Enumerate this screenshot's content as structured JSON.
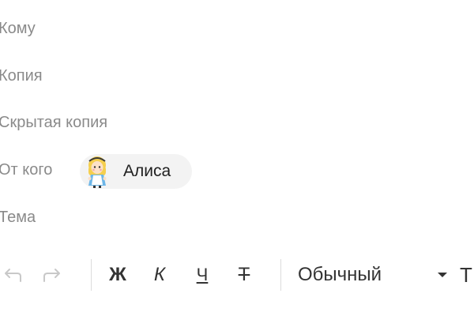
{
  "compose": {
    "to_label": "Кому",
    "cc_label": "Копия",
    "bcc_label": "Скрытая копия",
    "from_label": "От кого",
    "subject_label": "Тема",
    "sender": {
      "name": "Алиса",
      "avatar_icon": "alice-avatar-icon"
    }
  },
  "toolbar": {
    "undo_icon": "undo-icon",
    "redo_icon": "redo-icon",
    "bold_label": "Ж",
    "italic_label": "К",
    "underline_label": "Ч",
    "strikethrough_label": "Т",
    "paragraph_style": "Обычный",
    "paragraph_style_icon": "caret-down-icon",
    "text_color_label": "Т"
  },
  "colors": {
    "label_text": "#8a8a8a",
    "primary_text": "#1f1f1f",
    "chip_background": "#f3f3f3",
    "disabled_icon": "#c8c8c8",
    "separator": "#dcdcdc"
  }
}
